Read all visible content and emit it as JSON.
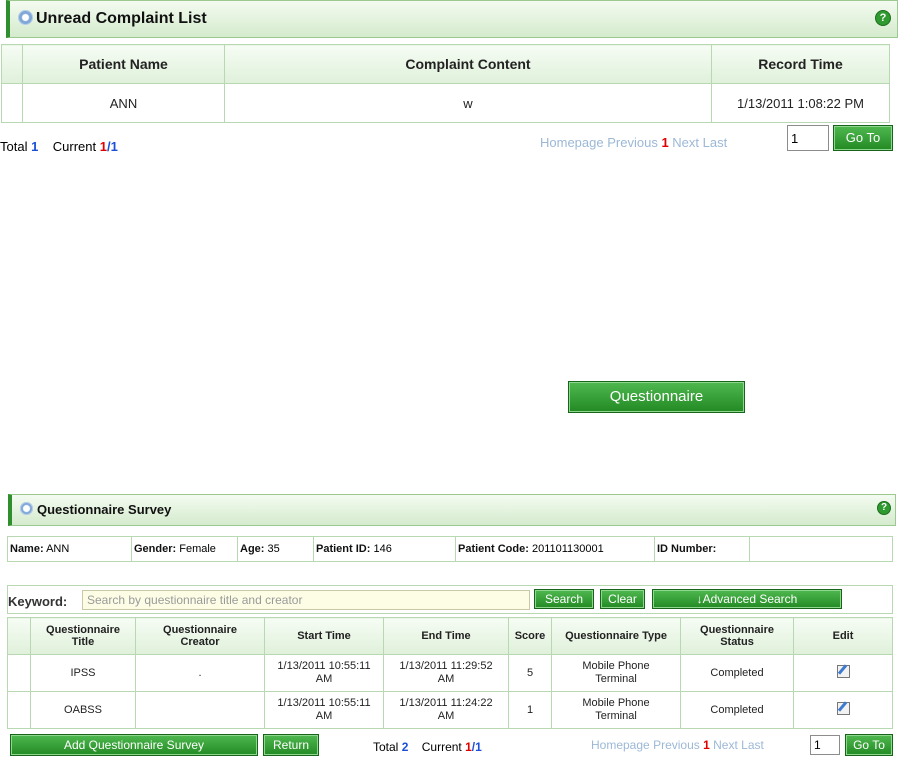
{
  "complaint": {
    "title": "Unread Complaint List",
    "columns": [
      "Patient Name",
      "Complaint Content",
      "Record Time"
    ],
    "rows": [
      {
        "patient_name": "ANN",
        "content": "w",
        "record_time": "1/13/2011 1:08:22 PM"
      }
    ],
    "pager": {
      "total_label": "Total",
      "total": "1",
      "current_label": "Current",
      "current_page": "1",
      "page_count": "/1",
      "homepage": "Homepage",
      "previous": "Previous",
      "page": "1",
      "next": "Next",
      "last": "Last",
      "goto_value": "1",
      "goto_button": "Go To"
    }
  },
  "questionnaire_button": "Questionnaire",
  "survey": {
    "title": "Questionnaire Survey",
    "patient": {
      "name_label": "Name:",
      "name": "ANN",
      "gender_label": "Gender:",
      "gender": "Female",
      "age_label": "Age:",
      "age": "35",
      "patient_id_label": "Patient ID:",
      "patient_id": "146",
      "patient_code_label": "Patient Code:",
      "patient_code": "201101130001",
      "id_number_label": "ID Number:",
      "id_number": ""
    },
    "search": {
      "keyword_label": "Keyword:",
      "placeholder": "Search by questionnaire title and creator",
      "search_button": "Search",
      "clear_button": "Clear",
      "advanced_button": "↓Advanced Search"
    },
    "columns": {
      "title_1": "Questionnaire",
      "title_2": "Title",
      "creator_1": "Questionnaire",
      "creator_2": "Creator",
      "start": "Start Time",
      "end": "End Time",
      "score": "Score",
      "type": "Questionnaire Type",
      "status_1": "Questionnaire",
      "status_2": "Status",
      "edit": "Edit"
    },
    "rows": [
      {
        "title": "IPSS",
        "creator": ".",
        "start_1": "1/13/2011 10:55:11",
        "start_2": "AM",
        "end_1": "1/13/2011 11:29:52",
        "end_2": "AM",
        "score": "5",
        "type_1": "Mobile Phone",
        "type_2": "Terminal",
        "status": "Completed",
        "edit_icon": "edit-icon"
      },
      {
        "title": "OABSS",
        "creator": "",
        "start_1": "1/13/2011 10:55:11",
        "start_2": "AM",
        "end_1": "1/13/2011 11:24:22",
        "end_2": "AM",
        "score": "1",
        "type_1": "Mobile Phone",
        "type_2": "Terminal",
        "status": "Completed",
        "edit_icon": "edit-icon"
      }
    ],
    "add_button": "Add Questionnaire Survey",
    "return_button": "Return",
    "pager": {
      "total_label": "Total",
      "total": "2",
      "current_label": "Current",
      "current_page": "1",
      "page_count": "/1",
      "homepage": "Homepage",
      "previous": "Previous",
      "page": "1",
      "next": "Next",
      "last": "Last",
      "goto_value": "1",
      "goto_button": "Go To"
    }
  },
  "colors": {
    "accent_green": "#238a23",
    "border_green": "#b7d8b0",
    "current_page_red": "#e00000",
    "count_blue": "#1a4fd8",
    "pager_link_muted": "#9cb8d6"
  }
}
